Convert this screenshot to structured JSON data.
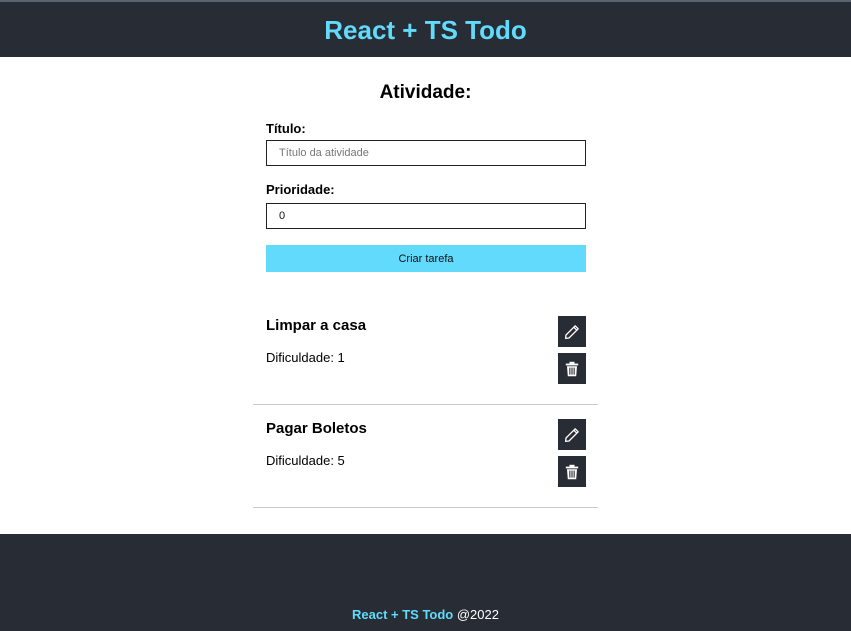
{
  "header": {
    "title": "React + TS Todo"
  },
  "form": {
    "heading": "Atividade:",
    "title_label": "Título:",
    "title_placeholder": "Título da atividade",
    "title_value": "",
    "priority_label": "Prioridade:",
    "priority_value": "0",
    "submit_label": "Criar tarefa"
  },
  "tasks": [
    {
      "title": "Limpar a casa",
      "difficulty": "Dificuldade: 1"
    },
    {
      "title": "Pagar Boletos",
      "difficulty": "Dificuldade: 5"
    }
  ],
  "icons": {
    "edit": "pencil-icon",
    "delete": "trash-icon"
  },
  "colors": {
    "dark": "#282c34",
    "accent": "#61dafb"
  },
  "footer": {
    "brand": "React + TS Todo",
    "suffix": " @2022"
  }
}
